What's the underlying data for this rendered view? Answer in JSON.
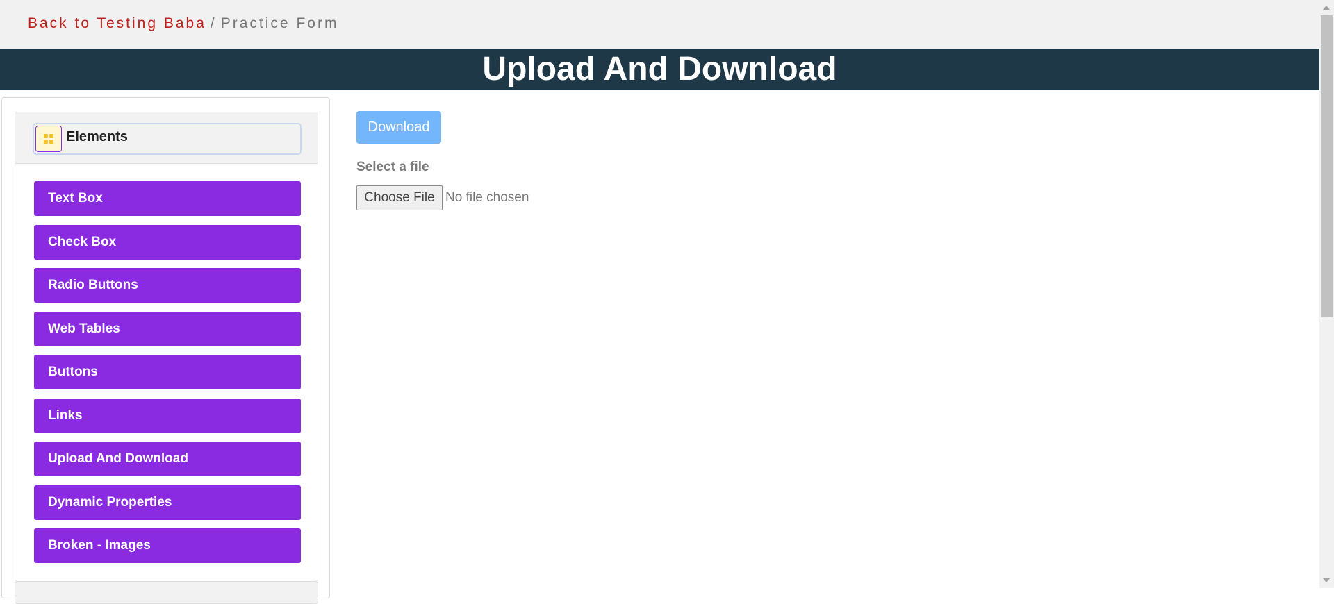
{
  "breadcrumb": {
    "link_label": "Back to Testing Baba",
    "separator": "/",
    "current": "Practice Form"
  },
  "header": {
    "title": "Upload And Download"
  },
  "sidebar": {
    "group_title": "Elements",
    "group_icon": "grid-icon",
    "items": [
      {
        "label": "Text Box"
      },
      {
        "label": "Check Box"
      },
      {
        "label": "Radio Buttons"
      },
      {
        "label": "Web Tables"
      },
      {
        "label": "Buttons"
      },
      {
        "label": "Links"
      },
      {
        "label": "Upload And Download"
      },
      {
        "label": "Dynamic Properties"
      },
      {
        "label": "Broken - Images"
      }
    ]
  },
  "main": {
    "download_label": "Download",
    "select_label": "Select a file",
    "choose_file_label": "Choose File",
    "no_file_text": "No file chosen"
  },
  "colors": {
    "banner": "#1f3847",
    "menu_item": "#8a2be2",
    "download_button": "#74b6fb",
    "breadcrumb_link": "#c0201a"
  }
}
